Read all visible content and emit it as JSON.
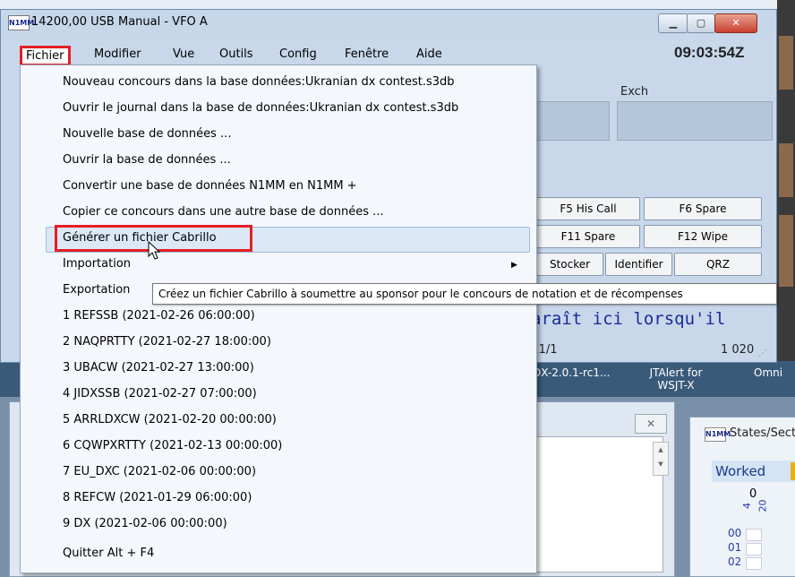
{
  "window": {
    "title": "14200,00 USB Manual - VFO A",
    "logo": "N1MM",
    "clock": "09:03:54Z",
    "controls": [
      "minimize-icon",
      "maximize-icon",
      "close-icon"
    ]
  },
  "menubar": {
    "items": [
      {
        "label": "Fichier"
      },
      {
        "label": "Modifier"
      },
      {
        "label": "Vue"
      },
      {
        "label": "Outils"
      },
      {
        "label": "Config"
      },
      {
        "label": "Fenêtre"
      },
      {
        "label": "Aide"
      }
    ]
  },
  "entry": {
    "exch_label": "Exch"
  },
  "function_keys": {
    "f5": "F5 His Call",
    "f6": "F6 Spare",
    "f11": "F11 Spare",
    "f12": "F12 Wipe",
    "stocker": "Stocker",
    "identifier": "Identifier",
    "qrz": "QRZ"
  },
  "status": {
    "message": "araît ici lorsqu'il",
    "qsy": "/11/1",
    "count": "1 020"
  },
  "taskbar": {
    "items": [
      {
        "label": "DX-2.0.1-rc1..."
      },
      {
        "label": "JTAlert for WSJT-X"
      },
      {
        "label": "Omni"
      }
    ]
  },
  "states_window": {
    "logo": "N1MM",
    "title": "States/Sect",
    "tab": "Worked",
    "count": "0",
    "vlabel1": "4",
    "vlabel2": "20",
    "rows": [
      "00",
      "01",
      "02"
    ]
  },
  "fichier_menu": {
    "items": [
      {
        "label": "Nouveau concours dans la base données:Ukranian dx contest.s3db"
      },
      {
        "label": "Ouvrir le journal dans la base de données:Ukranian dx contest.s3db"
      },
      {
        "label": "Nouvelle base de données ..."
      },
      {
        "label": "Ouvrir la base de données ..."
      },
      {
        "label": "Convertir une base de données N1MM en N1MM +"
      },
      {
        "label": "Copier ce concours dans une autre base de données ..."
      },
      {
        "label": "Générer un fichier Cabrillo",
        "highlighted": true
      },
      {
        "label": "Importation",
        "submenu": true
      },
      {
        "label": "Exportation"
      },
      {
        "label": "1 REFSSB (2021-02-26 06:00:00)"
      },
      {
        "label": "2 NAQPRTTY (2021-02-27 18:00:00)"
      },
      {
        "label": "3 UBACW (2021-02-27 13:00:00)"
      },
      {
        "label": "4 JIDXSSB (2021-02-27 07:00:00)"
      },
      {
        "label": "5 ARRLDXCW (2021-02-20 00:00:00)"
      },
      {
        "label": "6 CQWPXRTTY (2021-02-13 00:00:00)"
      },
      {
        "label": "7 EU_DXC (2021-02-06 00:00:00)"
      },
      {
        "label": "8 REFCW (2021-01-29 06:00:00)"
      },
      {
        "label": "9 DX (2021-02-06 00:00:00)"
      },
      {
        "label": "Quitter Alt + F4"
      }
    ]
  },
  "tooltip": {
    "text": "Créez un fichier Cabrillo à soumettre au sponsor pour le concours de notation et de récompenses"
  },
  "colors": {
    "annotation_red": "#e41e26",
    "menu_highlight": "#dce8f6",
    "status_blue": "#1a2a9a"
  }
}
